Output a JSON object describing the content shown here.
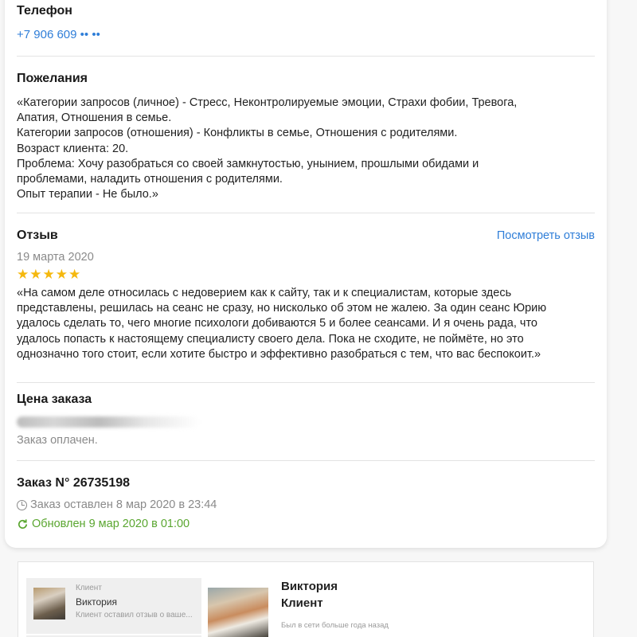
{
  "phone": {
    "heading": "Телефон",
    "number": "+7 906 609 •• ••"
  },
  "wishes": {
    "heading": "Пожелания",
    "lines": [
      "«Категории запросов (личное) - Стресс, Неконтролируемые эмоции, Страхи фобии, Тревога,",
      "Апатия, Отношения в семье.",
      "Категории запросов (отношения) - Конфликты в семье, Отношения с родителями.",
      "Возраст клиента: 20.",
      "Проблема: Хочу разобраться со своей замкнутостью, унынием, прошлыми обидами и",
      "проблемами, наладить отношения с родителями.",
      "Опыт терапии - Не было.»"
    ]
  },
  "review": {
    "heading": "Отзыв",
    "view_link": "Посмотреть отзыв",
    "date": "19 марта 2020",
    "rating": 5,
    "rating_max": 5,
    "star_color": "#f5b80e",
    "lines": [
      "«На самом деле относилась с недоверием как к сайту, так и к специалистам, которые здесь",
      "представлены, решилась на сеанс не сразу, но нисколько об этом не жалею. За один сеанс Юрию",
      "удалось сделать то, чего многие психологи добиваются 5 и более сеансами. И я очень рада, что",
      "удалось попасть к настоящему специалисту своего дела. Пока не сходите, не поймёте, но это",
      "однозначно того стоит, если хотите быстро и эффективно разобраться с тем, что вас беспокоит.»"
    ]
  },
  "price": {
    "heading": "Цена заказа",
    "status": "Заказ оплачен."
  },
  "order": {
    "heading": "Заказ N° 26735198",
    "created": "Заказ оставлен 8 мар 2020 в 23:44",
    "updated": "Обновлен 9 мар 2020 в 01:00",
    "updated_color": "#5aa630"
  },
  "chat": {
    "item": {
      "role": "Клиент",
      "name": "Виктория",
      "preview": "Клиент оставил отзыв о ваше..."
    },
    "profile": {
      "name": "Виктория",
      "role": "Клиент",
      "status": "Был в сети больше года назад"
    }
  },
  "colors": {
    "link": "#2f7ed8",
    "muted": "#8a8a8a",
    "divider": "#e3e3e3"
  }
}
